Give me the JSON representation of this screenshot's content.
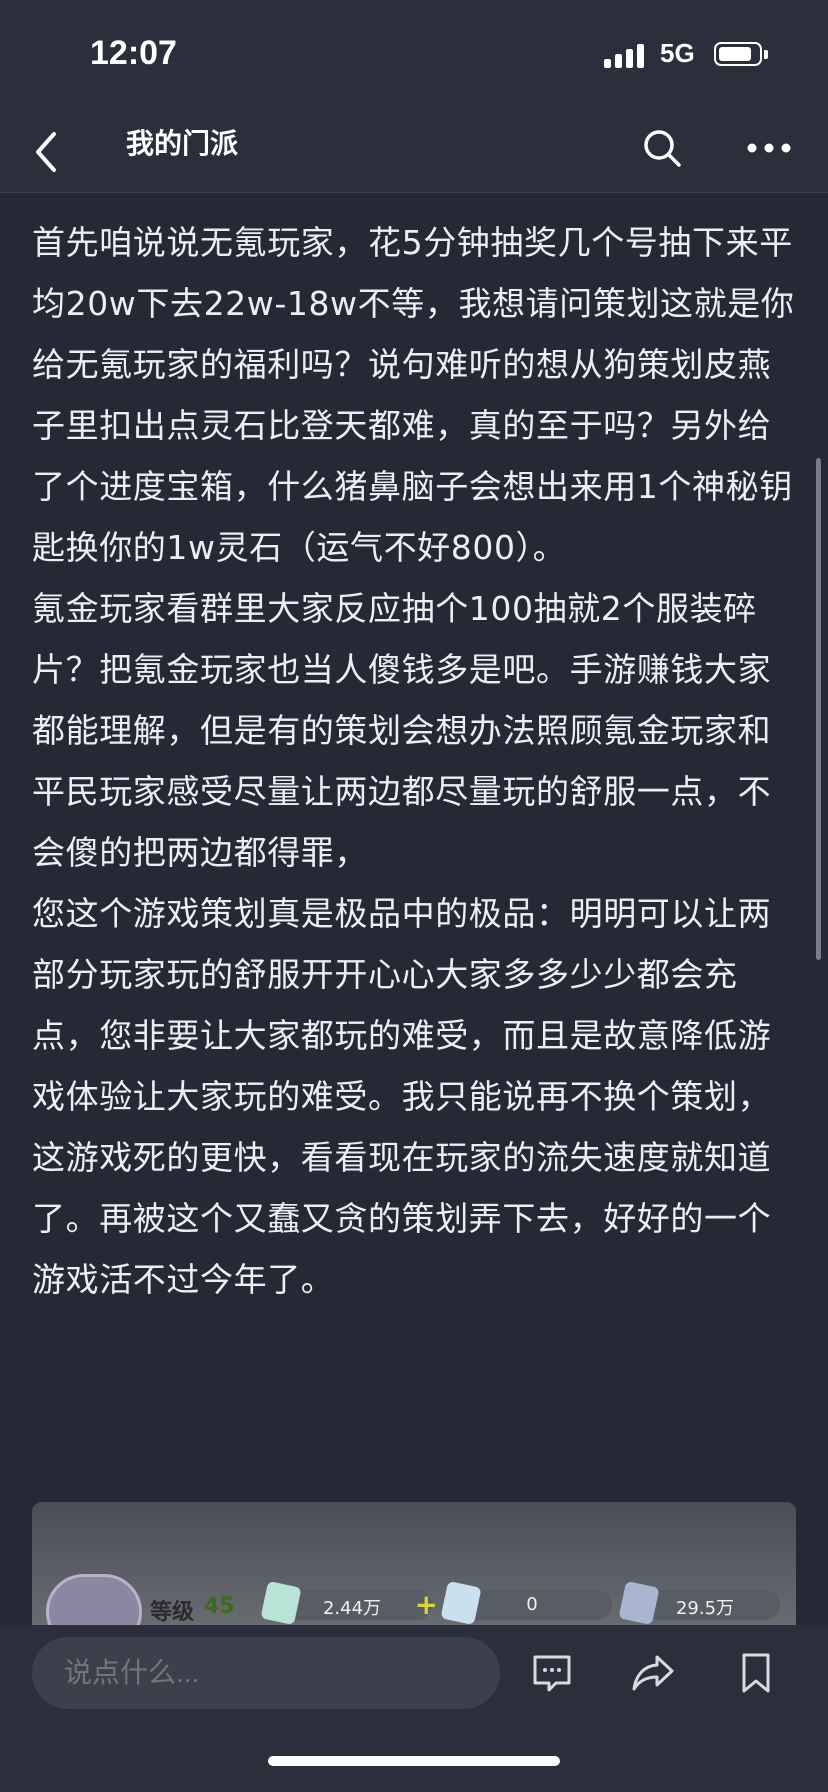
{
  "status_bar": {
    "time": "12:07",
    "network": "5G"
  },
  "nav": {
    "title": "我的门派"
  },
  "post": {
    "paragraphs": [
      "首先咱说说无氪玩家，花5分钟抽奖几个号抽下来平均20w下去22w-18w不等，我想请问策划这就是你给无氪玩家的福利吗？说句难听的想从狗策划皮燕子里扣出点灵石比登天都难，真的至于吗？另外给了个进度宝箱，什么猪鼻脑子会想出来用1个神秘钥匙换你的1w灵石（运气不好800）。",
      "氪金玩家看群里大家反应抽个100抽就2个服装碎片？把氪金玩家也当人傻钱多是吧。手游赚钱大家都能理解，但是有的策划会想办法照顾氪金玩家和平民玩家感受尽量让两边都尽量玩的舒服一点，不会傻的把两边都得罪，",
      "您这个游戏策划真是极品中的极品：明明可以让两部分玩家玩的舒服开开心心大家多多少少都会充点，您非要让大家都玩的难受，而且是故意降低游戏体验让大家玩的难受。我只能说再不换个策划，这游戏死的更快，看看现在玩家的流失速度就知道了。再被这个又蠢又贪的策划弄下去，好好的一个游戏活不过今年了。"
    ]
  },
  "image_card": {
    "level_label": "等级",
    "level_value": "45",
    "resources": [
      {
        "value": "2.44万",
        "gem_color": "#b9e3d6"
      },
      {
        "value": "0",
        "gem_color": "#c9e0ee"
      },
      {
        "value": "29.5万",
        "gem_color": "#a9b6cf"
      }
    ]
  },
  "bottom_bar": {
    "comment_placeholder": "说点什么..."
  }
}
